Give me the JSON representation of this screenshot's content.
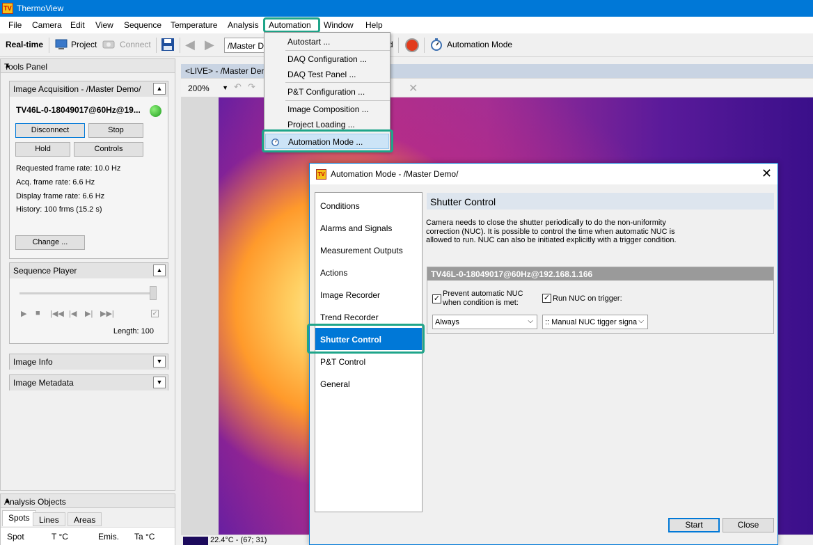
{
  "app": {
    "title": "ThermoView",
    "icon": "tv-app-icon",
    "icon_text": "TV"
  },
  "menu": [
    "File",
    "Camera",
    "Edit",
    "View",
    "Sequence",
    "Temperature",
    "Analysis",
    "Automation",
    "Window",
    "Help"
  ],
  "toolbar": {
    "realtime": "Real-time",
    "project": "Project",
    "connect": "Connect",
    "path": "/Master D",
    "trailing_d": "d",
    "automation_mode": "Automation Mode"
  },
  "dropdown": {
    "items": [
      "Autostart ...",
      "DAQ Configuration ...",
      "DAQ Test Panel ...",
      "P&T Configuration ...",
      "Image Composition ...",
      "Project Loading ...",
      "Automation Mode ..."
    ]
  },
  "tools_panel": {
    "title": "Tools Panel",
    "image_acquisition": {
      "title": "Image Acquisition - /Master Demo/",
      "device": "TV46L-0-18049017@60Hz@19...",
      "buttons": {
        "disconnect": "Disconnect",
        "stop": "Stop",
        "hold": "Hold",
        "controls": "Controls",
        "change": "Change ..."
      },
      "stats": [
        "Requested frame rate: 10.0 Hz",
        "Acq. frame rate: 6.6 Hz",
        "Display frame rate: 6.6 Hz",
        "History: 100 frms (15.2 s)"
      ]
    },
    "sequence_player": {
      "title": "Sequence Player",
      "length": "Length: 100"
    },
    "image_info": "Image Info",
    "image_metadata": "Image Metadata"
  },
  "analysis": {
    "title": "Analysis Objects",
    "tabs": [
      "Spots",
      "Lines",
      "Areas"
    ],
    "columns": [
      "Spot",
      "T °C",
      "Emis.",
      "Ta °C"
    ]
  },
  "live": {
    "tab": "<LIVE> - /Master Dem",
    "zoom": "200%",
    "status": "22.4°C - (67; 31)"
  },
  "dialog": {
    "title": "Automation Mode - /Master Demo/",
    "nav": [
      "Conditions",
      "Alarms and Signals",
      "Measurement Outputs",
      "Actions",
      "Image Recorder",
      "Trend Recorder",
      "Shutter Control",
      "P&T Control",
      "General"
    ],
    "active_nav": "Shutter Control",
    "section_title": "Shutter Control",
    "description": "Camera needs to close the shutter periodically to do the non-uniformity correction (NUC). It is possible to control the time when automatic NUC is allowed to run. NUC can also be initiated explicitly with a trigger condition.",
    "device": "TV46L-0-18049017@60Hz@192.168.1.166",
    "prevent_nuc_label_1": "Prevent automatic NUC",
    "prevent_nuc_label_2": "when condition is met:",
    "run_nuc_label": "Run NUC on trigger:",
    "condition_value": "Always",
    "trigger_value": ":: Manual NUC tigger signa",
    "start": "Start",
    "close": "Close"
  },
  "colors": {
    "accent": "#0078d7",
    "highlight_box": "#1fa58a",
    "nav_active": "#0078d7"
  }
}
